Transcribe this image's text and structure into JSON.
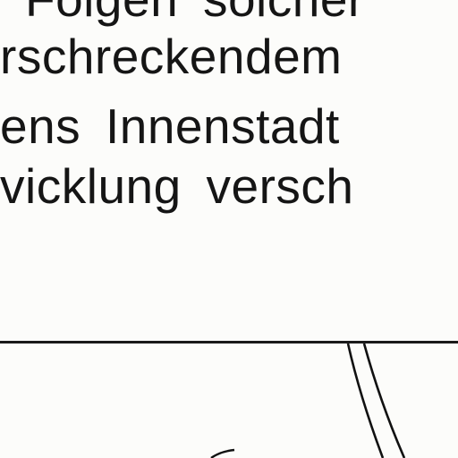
{
  "document": {
    "lines": [
      "Folgen solcher",
      "rschreckendem",
      "ens Innenstadt",
      "vicklung versch"
    ]
  }
}
